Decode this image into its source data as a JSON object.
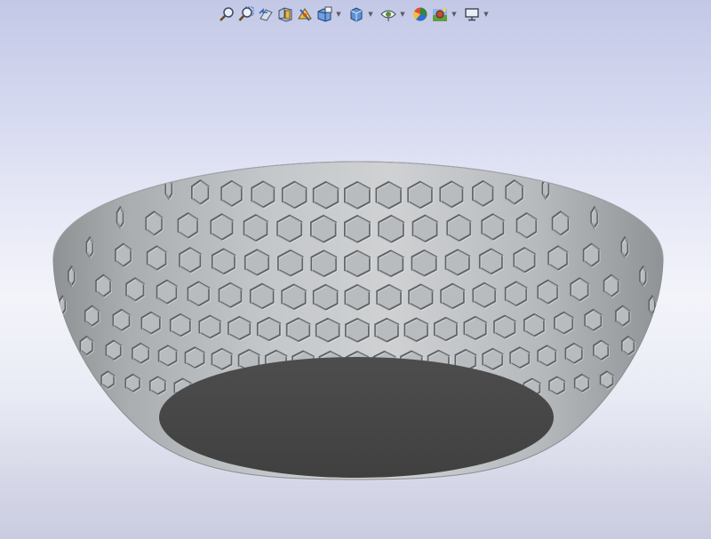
{
  "viewport": {
    "background_top": "#c3c8e6",
    "background_mid": "#f3f4fa",
    "background_bottom": "#c9cbe0",
    "model": {
      "name": "hexagon-perforated-bowl",
      "surface_color": "#b9bcbf",
      "hole_color": "#5f6468",
      "inner_floor_color": "#454545"
    }
  },
  "toolbar": {
    "buttons": [
      {
        "id": "zoom-to-fit",
        "icon": "zoom-to-fit-icon",
        "dropdown": false
      },
      {
        "id": "zoom-to-area",
        "icon": "zoom-to-area-icon",
        "dropdown": false
      },
      {
        "id": "previous-view",
        "icon": "previous-view-icon",
        "dropdown": false
      },
      {
        "id": "section-view",
        "icon": "section-view-icon",
        "dropdown": false
      },
      {
        "id": "dynamic-annotation-views",
        "icon": "dynamic-annotation-icon",
        "dropdown": false
      },
      {
        "id": "view-orientation",
        "icon": "view-orientation-icon",
        "dropdown": true
      },
      {
        "id": "display-style",
        "icon": "display-style-icon",
        "dropdown": true
      },
      {
        "id": "hide-show-items",
        "icon": "hide-show-items-icon",
        "dropdown": true
      },
      {
        "id": "edit-appearance",
        "icon": "edit-appearance-icon",
        "dropdown": false
      },
      {
        "id": "apply-scene",
        "icon": "apply-scene-icon",
        "dropdown": true
      },
      {
        "id": "view-settings",
        "icon": "view-settings-icon",
        "dropdown": true
      }
    ]
  }
}
